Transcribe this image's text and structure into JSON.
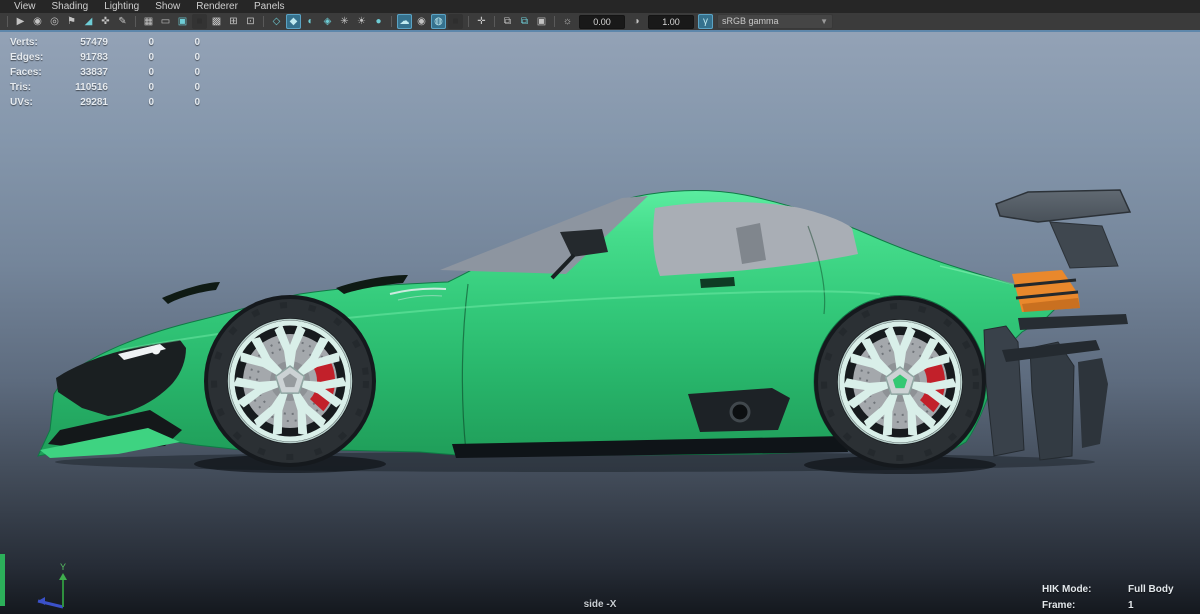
{
  "menu_bar": {
    "items": [
      "View",
      "Shading",
      "Lighting",
      "Show",
      "Renderer",
      "Panels"
    ]
  },
  "toolbar": {
    "exposure_value": "0.00",
    "contrast_value": "1.00",
    "color_transform": "sRGB gamma",
    "dropdown_caret": "▼",
    "icons": [
      {
        "name": "camera-icon",
        "glyph": "▶"
      },
      {
        "name": "select-camera-icon",
        "glyph": "◉"
      },
      {
        "name": "camera-attributes-icon",
        "glyph": "◎"
      },
      {
        "name": "bookmark-icon",
        "glyph": "⚑"
      },
      {
        "name": "image-plane-icon",
        "glyph": "◢"
      },
      {
        "name": "pan-zoom-icon",
        "glyph": "✜"
      },
      {
        "name": "grease-pencil-icon",
        "glyph": "✎"
      },
      {
        "name": "grid-icon",
        "glyph": "▦"
      },
      {
        "name": "film-gate-icon",
        "glyph": "▭"
      },
      {
        "name": "resolution-gate-icon",
        "glyph": "▣"
      },
      {
        "name": "gate-mask-icon",
        "glyph": "■"
      },
      {
        "name": "field-chart-icon",
        "glyph": "▩"
      },
      {
        "name": "safe-action-icon",
        "glyph": "⊞"
      },
      {
        "name": "safe-title-icon",
        "glyph": "⊡"
      },
      {
        "name": "wireframe-icon",
        "glyph": "◇"
      },
      {
        "name": "smooth-shade-icon",
        "glyph": "◆"
      },
      {
        "name": "textured-icon",
        "glyph": "◐"
      },
      {
        "name": "wireframe-on-shaded-icon",
        "glyph": "◈"
      },
      {
        "name": "xray-icon",
        "glyph": "✳"
      },
      {
        "name": "lights-icon",
        "glyph": "☀"
      },
      {
        "name": "shadows-icon",
        "glyph": "●"
      },
      {
        "name": "ssao-icon",
        "glyph": "☁"
      },
      {
        "name": "motion-blur-icon",
        "glyph": "◉"
      },
      {
        "name": "anti-aliasing-icon",
        "glyph": "◍"
      },
      {
        "name": "depth-of-field-icon",
        "glyph": "■"
      },
      {
        "name": "isolate-select-icon",
        "glyph": "✛"
      },
      {
        "name": "snapshot-icon",
        "glyph": "⧉"
      },
      {
        "name": "snapshot-2-icon",
        "glyph": "⧉"
      },
      {
        "name": "image-view-icon",
        "glyph": "▣"
      },
      {
        "name": "exposure-icon",
        "glyph": "☼"
      },
      {
        "name": "contrast-icon",
        "glyph": "◑"
      },
      {
        "name": "gamma-icon",
        "glyph": "γ"
      }
    ]
  },
  "hud": {
    "poly_count": {
      "rows": [
        {
          "label": "Verts:",
          "col1": "57479",
          "col2": "0",
          "col3": "0"
        },
        {
          "label": "Edges:",
          "col1": "91783",
          "col2": "0",
          "col3": "0"
        },
        {
          "label": "Faces:",
          "col1": "33837",
          "col2": "0",
          "col3": "0"
        },
        {
          "label": "Tris:",
          "col1": "110516",
          "col2": "0",
          "col3": "0"
        },
        {
          "label": "UVs:",
          "col1": "29281",
          "col2": "0",
          "col3": "0"
        }
      ]
    },
    "camera_label": "side -X",
    "hik_mode_label": "HIK Mode:",
    "hik_mode_value": "Full Body",
    "frame_label": "Frame:",
    "frame_value": "1",
    "axis_label_y": "Y"
  },
  "colors": {
    "body_green": "#33c97a",
    "wing_gray": "#5e676f",
    "taillight_orange": "#e9882c",
    "caliper_red": "#c2202a",
    "rim_mint": "#d9efe9",
    "hub_green": "#34c873",
    "viewport_top": "#93a2b6",
    "viewport_bottom": "#14181e",
    "accent_teal": "#6ecdd6",
    "active_toggle": "#35718d",
    "panel_highlight_blue": "#5e87ab",
    "hud_text": "#e6ebf0"
  }
}
